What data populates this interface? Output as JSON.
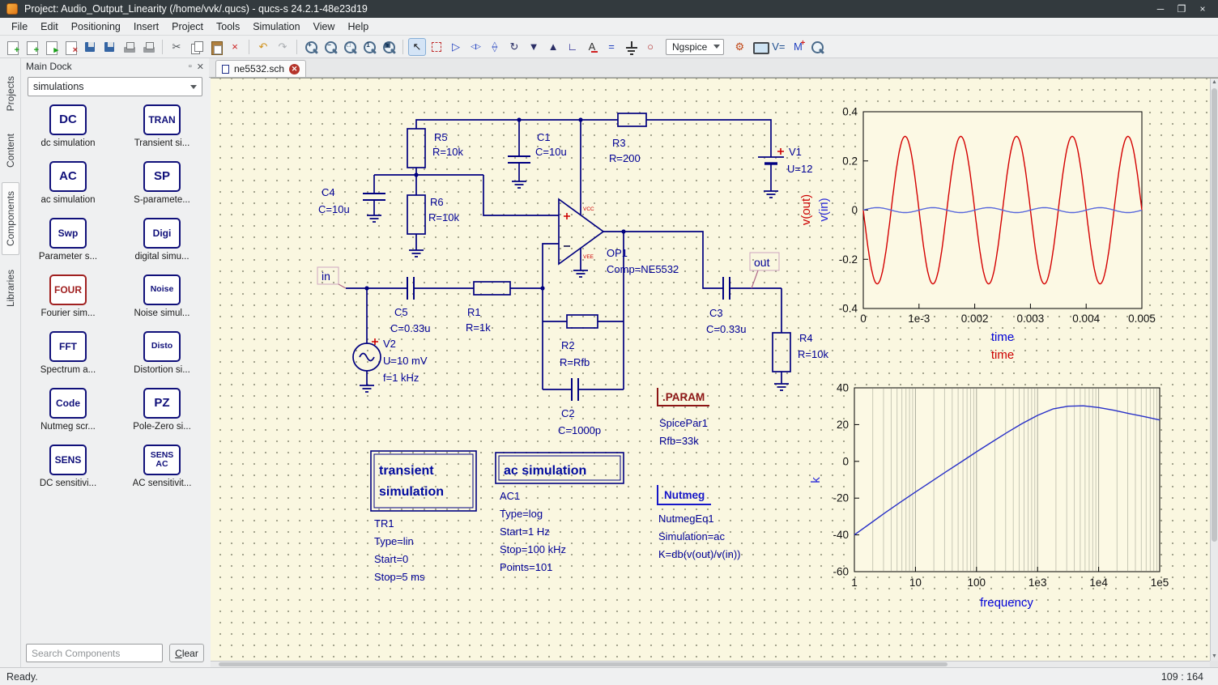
{
  "window": {
    "title": "Project: Audio_Output_Linearity (/home/vvk/.qucs) - qucs-s 24.2.1-48e23d19",
    "controls": {
      "minimize": "─",
      "maximize": "❐",
      "close": "×"
    }
  },
  "menu": {
    "items": [
      "File",
      "Edit",
      "Positioning",
      "Insert",
      "Project",
      "Tools",
      "Simulation",
      "View",
      "Help"
    ]
  },
  "toolbar": {
    "simulator": "Ngspice",
    "left_groups": [
      [
        {
          "n": "new-document-icon",
          "k": "page",
          "g": "+",
          "c": "#18a018"
        },
        {
          "n": "new-text-document-icon",
          "k": "page",
          "g": "+",
          "c": "#18a018"
        },
        {
          "n": "open-document-icon",
          "k": "page",
          "g": "▸",
          "c": "#18a018"
        },
        {
          "n": "close-document-icon",
          "k": "page",
          "g": "×",
          "c": "#c03030"
        },
        {
          "n": "save-icon",
          "k": "floppy",
          "g": ""
        },
        {
          "n": "save-all-icon",
          "k": "floppy",
          "g": ""
        },
        {
          "n": "print-icon",
          "k": "printer",
          "g": ""
        },
        {
          "n": "print-fit-icon",
          "k": "printer",
          "g": ""
        }
      ],
      [
        {
          "n": "cut-icon",
          "g": "✂",
          "c": "#50555a"
        },
        {
          "n": "copy-icon",
          "k": "copy",
          "g": ""
        },
        {
          "n": "paste-icon",
          "k": "paste",
          "g": ""
        },
        {
          "n": "delete-icon",
          "g": "×",
          "c": "#cc2020"
        }
      ],
      [
        {
          "n": "undo-icon",
          "g": "↶",
          "c": "#d09018"
        },
        {
          "n": "redo-icon",
          "g": "↷",
          "c": "#a8acb0"
        }
      ],
      [
        {
          "n": "zoom-in-icon",
          "k": "zoom",
          "g": "+"
        },
        {
          "n": "zoom-out-icon",
          "k": "zoom",
          "g": "−"
        },
        {
          "n": "zoom-fit-icon",
          "k": "zoom",
          "g": "□"
        },
        {
          "n": "zoom-1-1-icon",
          "k": "zoom",
          "g": "1"
        },
        {
          "n": "zoom-area-icon",
          "k": "zoom",
          "g": "▣"
        }
      ],
      [
        {
          "n": "pointer-icon",
          "g": "↖",
          "c": "#16181a",
          "active": true
        },
        {
          "n": "select-marker-icon",
          "k": "dashed",
          "g": ""
        },
        {
          "n": "go-into-subcircuit-icon",
          "g": "▷",
          "c": "#2040c0"
        },
        {
          "n": "mirror-y-icon",
          "k": "mirror",
          "g": "◁▷",
          "c": "#2040c0"
        },
        {
          "n": "mirror-x-icon",
          "k": "mirror rot90",
          "g": "◁▷",
          "c": "#2040c0"
        },
        {
          "n": "rotate-icon",
          "g": "↻",
          "c": "#2a2e66"
        },
        {
          "n": "move-down-icon",
          "g": "▼",
          "c": "#2a2e66"
        },
        {
          "n": "move-up-icon",
          "g": "▲",
          "c": "#2a2e66"
        },
        {
          "n": "wire-icon",
          "g": "∟",
          "c": "#000080"
        },
        {
          "n": "wire-label-icon",
          "k": "label-ico",
          "g": "A",
          "c": "#303030"
        },
        {
          "n": "equation-icon",
          "g": "=",
          "c": "#2040c0"
        },
        {
          "n": "ground-icon",
          "k": "ground",
          "g": ""
        },
        {
          "n": "port-icon",
          "g": "○",
          "c": "#b02828"
        }
      ]
    ],
    "right_groups": [
      [
        {
          "n": "simulate-gear-icon",
          "g": "⚙",
          "c": "#c04818"
        },
        {
          "n": "view-data-display-icon",
          "k": "display",
          "g": ""
        },
        {
          "n": "dc-bias-icon",
          "g": "V=",
          "c": "#205090"
        },
        {
          "n": "marker-icon",
          "k": "marker",
          "g": "M",
          "c": "#2040c0"
        },
        {
          "n": "zoom-data-icon",
          "k": "zoom",
          "g": ""
        }
      ]
    ]
  },
  "dock": {
    "title": "Main Dock",
    "tabs": [
      "Projects",
      "Content",
      "Components",
      "Libraries"
    ],
    "active_tab": "Components",
    "filter": "simulations",
    "components": [
      {
        "icon": "DC",
        "label": "dc simulation"
      },
      {
        "icon": "TRAN",
        "label": "Transient si..."
      },
      {
        "icon": "AC",
        "label": "ac simulation"
      },
      {
        "icon": "SP",
        "label": "S-paramete..."
      },
      {
        "icon": "Swp",
        "label": "Parameter s..."
      },
      {
        "icon": "Digi",
        "label": "digital simu..."
      },
      {
        "icon": "FOUR",
        "label": "Fourier sim...",
        "accent": "#a02020"
      },
      {
        "icon": "Noise",
        "label": "Noise simul..."
      },
      {
        "icon": "FFT",
        "label": "Spectrum a..."
      },
      {
        "icon": "Disto",
        "label": "Distortion si..."
      },
      {
        "icon": "Code",
        "label": "Nutmeg scr..."
      },
      {
        "icon": "PZ",
        "label": "Pole-Zero si..."
      },
      {
        "icon": "SENS",
        "label": "DC sensitivi..."
      },
      {
        "icon": "SENS\nAC",
        "label": "AC sensitivit..."
      }
    ],
    "search_placeholder": "Search Components",
    "clear_label": "Clear"
  },
  "document": {
    "tab": "ne5532.sch"
  },
  "schematic": {
    "components": {
      "R5": {
        "name": "R5",
        "value": "R=10k"
      },
      "C1": {
        "name": "C1",
        "value": "C=10u"
      },
      "R3": {
        "name": "R3",
        "value": "R=200"
      },
      "V1": {
        "name": "V1",
        "value": "U=12"
      },
      "C4": {
        "name": "C4",
        "value": "C=10u"
      },
      "R6": {
        "name": "R6",
        "value": "R=10k"
      },
      "OP1": {
        "name": "OP1",
        "value": "Comp=NE5532"
      },
      "C5": {
        "name": "C5",
        "value": "C=0.33u"
      },
      "R1": {
        "name": "R1",
        "value": "R=1k"
      },
      "V2": {
        "name": "V2",
        "value": "U=10 mV",
        "value2": "f=1 kHz"
      },
      "R2": {
        "name": "R2",
        "value": "R=Rfb"
      },
      "C2": {
        "name": "C2",
        "value": "C=1000p"
      },
      "C3": {
        "name": "C3",
        "value": "C=0.33u"
      },
      "R4": {
        "name": "R4",
        "value": "R=10k"
      }
    },
    "net_labels": {
      "in": "in",
      "out": "out"
    },
    "opamp_marks": {
      "vcc": "VCC",
      "vee": "VEE"
    },
    "sim_transient": {
      "title_lines": [
        "transient",
        "simulation"
      ],
      "params": [
        "TR1",
        "Type=lin",
        "Start=0",
        "Stop=5 ms"
      ]
    },
    "sim_ac": {
      "title_lines": [
        "ac simulation"
      ],
      "params": [
        "AC1",
        "Type=log",
        "Start=1 Hz",
        "Stop=100 kHz",
        "Points=101"
      ]
    },
    "spice_param": {
      "title": ".PARAM",
      "params": [
        "SpicePar1",
        "Rfb=33k"
      ]
    },
    "nutmeg": {
      "title": "Nutmeg",
      "params": [
        "NutmegEq1",
        "Simulation=ac",
        "K=db(v(out)/v(in))"
      ]
    }
  },
  "chart_data": [
    {
      "type": "line",
      "id": "time-domain",
      "xlim": [
        0,
        0.005
      ],
      "ylim": [
        -0.4,
        0.4
      ],
      "xticks": [
        0,
        0.001,
        0.002,
        0.003,
        0.004,
        0.005
      ],
      "xtick_labels": [
        "0",
        "1e-3",
        "0.002",
        "0.003",
        "0.004",
        "0.005"
      ],
      "yticks": [
        0.4,
        0.2,
        0,
        -0.2,
        -0.4
      ],
      "ytick_labels": [
        "0.4",
        "0.2",
        "0",
        "-0.2",
        "-0.4"
      ],
      "xlabel_series": [
        {
          "label": "time",
          "color": "#0000d8"
        },
        {
          "label": "time",
          "color": "#cc0000"
        }
      ],
      "ylabels": [
        {
          "label": "v(out)",
          "color": "#cc0000"
        },
        {
          "label": "v(in)",
          "color": "#2828d8"
        }
      ],
      "series": [
        {
          "name": "v(out)",
          "color": "#d40000",
          "waveform": "sine",
          "amplitude": 0.3,
          "frequency_hz": 1000,
          "phase_deg": 180
        },
        {
          "name": "v(in)",
          "color": "#5868dc",
          "waveform": "sine",
          "amplitude": 0.01,
          "frequency_hz": 1000,
          "phase_deg": 0
        }
      ]
    },
    {
      "type": "line",
      "id": "frequency-response",
      "xscale": "log",
      "xlim": [
        1,
        100000
      ],
      "ylim": [
        -60,
        40
      ],
      "xticks": [
        1,
        10,
        100,
        1000,
        10000,
        100000
      ],
      "xtick_labels": [
        "1",
        "10",
        "100",
        "1e3",
        "1e4",
        "1e5"
      ],
      "yticks": [
        40,
        20,
        0,
        -20,
        -40,
        -60
      ],
      "ytick_labels": [
        "40",
        "20",
        "0",
        "-20",
        "-40",
        "-60"
      ],
      "xlabel": {
        "label": "frequency",
        "color": "#0000d8"
      },
      "ylabel": {
        "label": "k",
        "color": "#2828d8"
      },
      "series": [
        {
          "name": "k",
          "color": "#2830c8",
          "points": [
            [
              1,
              -40
            ],
            [
              1.78,
              -34
            ],
            [
              3.16,
              -28
            ],
            [
              5.62,
              -22.3
            ],
            [
              10,
              -16.7
            ],
            [
              17.8,
              -11.2
            ],
            [
              31.6,
              -5.7
            ],
            [
              56.2,
              -0.3
            ],
            [
              100,
              5.2
            ],
            [
              178,
              10.5
            ],
            [
              316,
              15.7
            ],
            [
              562,
              20.6
            ],
            [
              1000,
              25
            ],
            [
              1780,
              28.5
            ],
            [
              3160,
              30
            ],
            [
              5620,
              30.2
            ],
            [
              10000,
              29.3
            ],
            [
              17800,
              27.8
            ],
            [
              31600,
              26
            ],
            [
              56200,
              24.3
            ],
            [
              100000,
              22.5
            ]
          ]
        }
      ]
    }
  ],
  "statusbar": {
    "left": "Ready.",
    "right": "109 : 164"
  }
}
